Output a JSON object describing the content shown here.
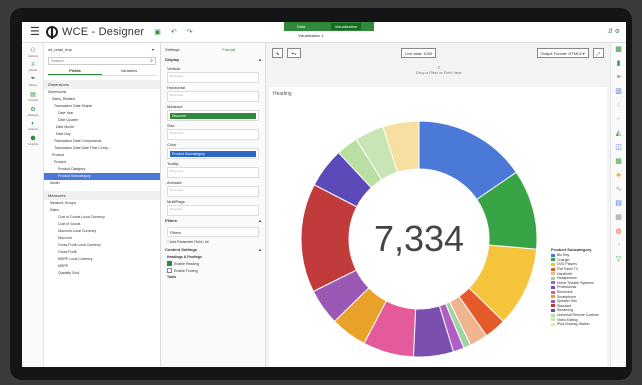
{
  "app": {
    "title": "WCE - Designer",
    "modes": [
      "Data",
      "Visualization"
    ],
    "visualization_title": "Visualization 1"
  },
  "left_nav": [
    "Authors",
    "Fields",
    "Filters",
    "Format",
    "Settings",
    "Actions",
    "Insights"
  ],
  "fields_panel": {
    "dataset": "wf_retail_tmp",
    "search_placeholder": "Search",
    "tabs": [
      "Fields",
      "Variables"
    ],
    "dimensions_title": "Dimensions",
    "dimension_items": [
      "Dimensions",
      "Sales_Related",
      "Transaction Date Simple",
      "Date Year",
      "Date Quarter",
      "Date Month",
      "Date Day",
      "Transaction Date Components",
      "Transaction Date Date Time Comp...",
      "Product",
      "Product",
      "Product Category",
      "Product Subcategory",
      "Model"
    ],
    "measures_title": "Measures",
    "measure_items": [
      "Measure Groups",
      "Sales",
      "Cost of Goods Local Currency",
      "Cost of Goods",
      "Discount Local Currency",
      "Discount",
      "Gross Profit Local Currency",
      "Gross Profit",
      "MSRP Local Currency",
      "MSRP",
      "Quantity Sold"
    ]
  },
  "settings_panel": {
    "tabs": [
      "Settings",
      "Format"
    ],
    "display_title": "Display",
    "slots": [
      {
        "label": "Vertical",
        "value": ""
      },
      {
        "label": "Horizontal",
        "value": ""
      },
      {
        "label": "Measure",
        "value": "Discount",
        "color": "#2f8b3b"
      },
      {
        "label": "Size",
        "value": ""
      },
      {
        "label": "Color",
        "value": "Product Subcategory",
        "color": "#2b67c6"
      },
      {
        "label": "Tooltip",
        "value": ""
      },
      {
        "label": "Animate",
        "value": ""
      },
      {
        "label": "MultiPage",
        "value": ""
      }
    ],
    "drop_placeholder": "Drop here",
    "filters_title": "Filters",
    "filters_value": "Filters",
    "add_param": "+ Add Parameter Field / ##",
    "content_title": "Content Settings",
    "headings_title": "Headings & Footings",
    "enable_heading": "Enable Heading",
    "enable_footing": "Enable Footing",
    "tools": "Tools"
  },
  "canvas": {
    "live_data": "Live data: 1000",
    "output_format": "Output Format: HTML5 ▾",
    "drop_hint": "Drop a Filter or Field here",
    "heading": "Heading",
    "center_value": "7,334",
    "legend_title": "Product Subcategory"
  },
  "chart_data": {
    "type": "pie",
    "center_value": "7,334",
    "legend_title": "Product Subcategory",
    "categories": [
      "Blu Ray",
      "Charger",
      "DVD Players",
      "Flat Panel TV",
      "Handheld",
      "Headphones",
      "Home Theater Systems",
      "Professional",
      "Receivers",
      "Smartphone",
      "Speaker Kits",
      "Standard",
      "Streaming",
      "Universal Remote Controls",
      "Video Editing",
      "iPod Docking Station"
    ],
    "values": [
      15.5,
      11,
      11,
      3,
      2.5,
      1,
      1.5,
      5.5,
      7,
      5,
      5,
      15,
      5.5,
      3,
      4,
      5
    ],
    "colors": [
      "#4a79d8",
      "#39a446",
      "#f5c43b",
      "#e55a2b",
      "#f0b48e",
      "#9fd2a5",
      "#b05ec4",
      "#7a4fb0",
      "#e55a9a",
      "#e8a22a",
      "#9b59b6",
      "#c23b3b",
      "#5b4ab8",
      "#b9dfa3",
      "#c8e6b5",
      "#f6dfa0"
    ]
  }
}
